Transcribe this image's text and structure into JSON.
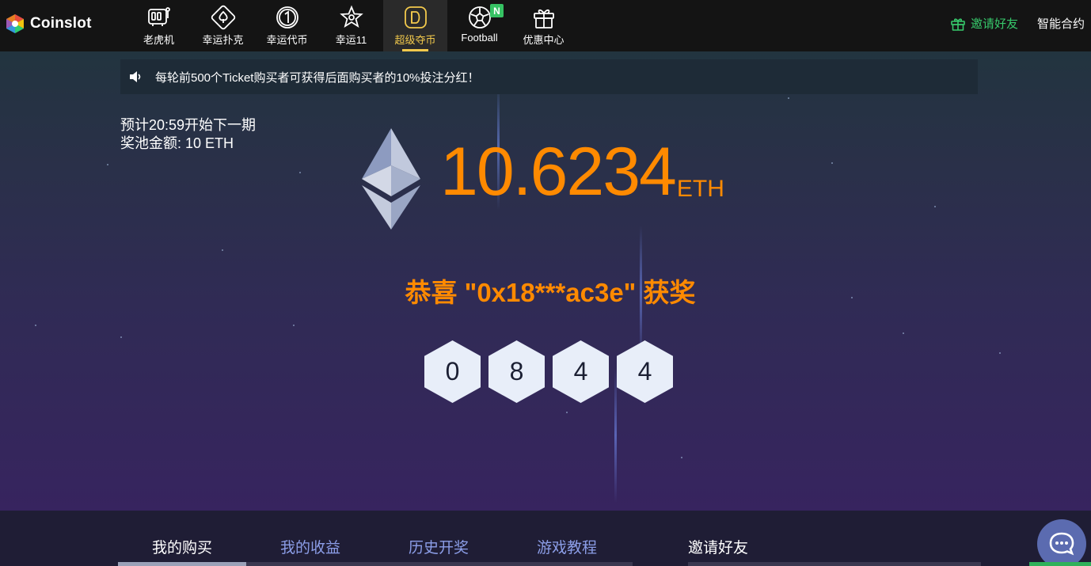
{
  "brand": {
    "name": "Coinslot",
    "logo_icon": "coinslot-logo-icon"
  },
  "nav": {
    "items": [
      {
        "label": "老虎机",
        "icon": "slot-machine-icon",
        "active": false
      },
      {
        "label": "幸运扑克",
        "icon": "spade-icon",
        "active": false
      },
      {
        "label": "幸运代币",
        "icon": "coin-one-icon",
        "active": false
      },
      {
        "label": "幸运11",
        "icon": "star-icon",
        "active": false
      },
      {
        "label": "超级夺币",
        "icon": "d-coin-icon",
        "active": true
      },
      {
        "label": "Football",
        "icon": "football-icon",
        "active": false,
        "badge": "N"
      },
      {
        "label": "优惠中心",
        "icon": "gift-box-icon",
        "active": false
      }
    ],
    "invite_label": "邀请好友",
    "contract_label": "智能合约"
  },
  "notice": {
    "text": "每轮前500个Ticket购买者可获得后面购买者的10%投注分红！"
  },
  "round": {
    "next_text": "预计20:59开始下一期",
    "pool_text": "奖池金额: 10 ETH"
  },
  "jackpot": {
    "value": "10.6234",
    "unit": "ETH"
  },
  "winner_text": "恭喜 \"0x18***ac3e\" 获奖",
  "winning_numbers": [
    "0",
    "8",
    "4",
    "4"
  ],
  "tabs": [
    {
      "label": "我的购买",
      "active": true
    },
    {
      "label": "我的收益",
      "active": false
    },
    {
      "label": "历史开奖",
      "active": false
    },
    {
      "label": "游戏教程",
      "active": false
    }
  ],
  "invite_panel": {
    "title": "邀请好友"
  },
  "colors": {
    "accent_orange": "#ff8a00",
    "active_nav_gold": "#f2c94c",
    "invite_green": "#37c96b",
    "tab_inactive": "#8c9ee8"
  }
}
